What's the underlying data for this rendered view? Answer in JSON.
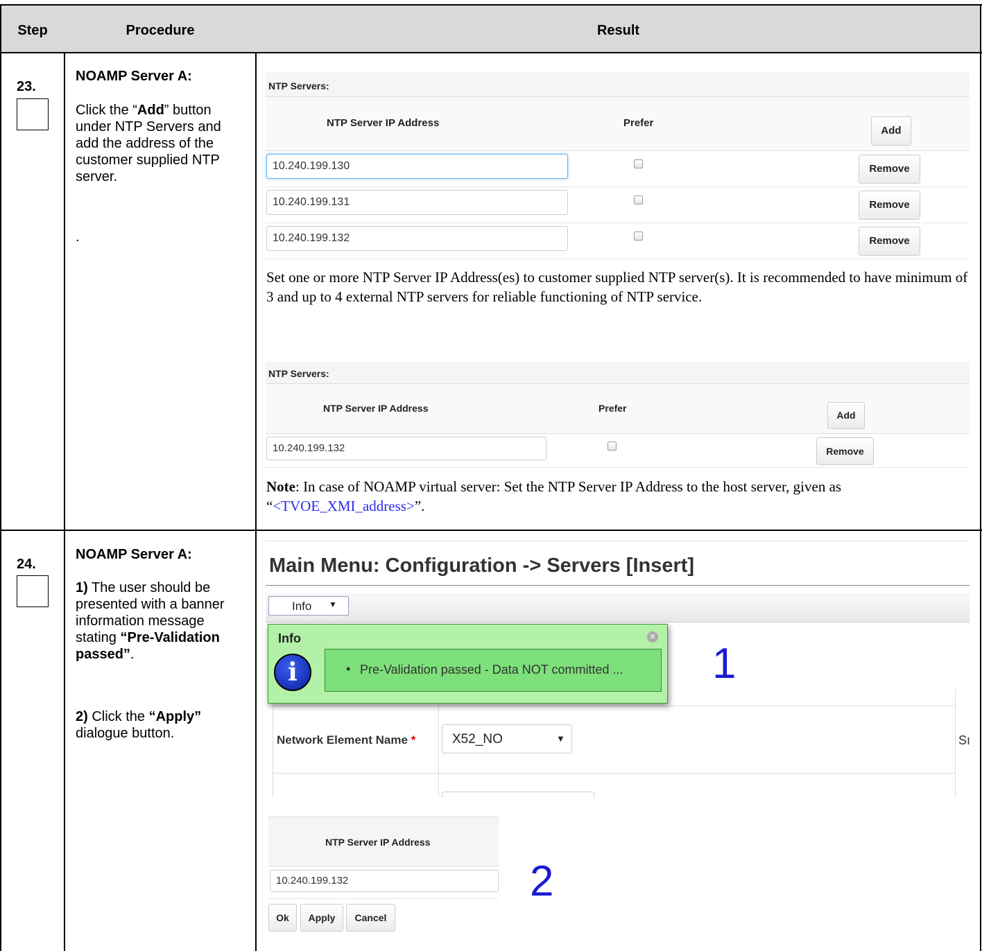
{
  "table": {
    "headers": {
      "step": "Step",
      "procedure": "Procedure",
      "result": "Result"
    }
  },
  "rows": [
    {
      "step": "23.",
      "procedure": {
        "title": "NOAMP Server A:",
        "p1_pre": "Click the “",
        "p1_bold": "Add",
        "p1_post": "” button under NTP Servers and add the address of the customer supplied NTP server.",
        "dot": "."
      },
      "result": {
        "panel1": {
          "section_title": "NTP Servers:",
          "col_ip": "NTP Server IP Address",
          "col_prefer": "Prefer",
          "add_button": "Add",
          "entries": [
            {
              "ip": "10.240.199.130",
              "remove": "Remove"
            },
            {
              "ip": "10.240.199.131",
              "remove": "Remove"
            },
            {
              "ip": "10.240.199.132",
              "remove": "Remove"
            }
          ]
        },
        "text1": "Set one or more NTP Server IP Address(es) to customer supplied NTP server(s).  It is recommended to have minimum of 3 and up to 4 external NTP servers for reliable functioning of NTP service.",
        "panel2": {
          "section_title": "NTP Servers:",
          "col_ip": "NTP Server IP Address",
          "col_prefer": "Prefer",
          "add_button": "Add",
          "entries": [
            {
              "ip": "10.240.199.132",
              "remove": "Remove"
            }
          ]
        },
        "note_label": "Note",
        "note_text": ": In case of NOAMP virtual server: Set the NTP Server IP Address to the host server, given as “",
        "note_link": "<TVOE_XMI_address>",
        "note_end": "”."
      }
    },
    {
      "step": "24.",
      "procedure": {
        "title": "NOAMP Server A:",
        "p1_num": "1)",
        "p1_text": " The user should be presented with a banner information message stating ",
        "p1_bold": "“Pre-Validation passed”",
        "p1_end": ".",
        "p2_num": "2)",
        "p2_text": " Click the ",
        "p2_bold": "“Apply”",
        "p2_end": " dialogue button."
      },
      "result": {
        "page_title": "Main Menu: Configuration -> Servers [Insert]",
        "info_dropdown": "Info",
        "banner_title": "Info",
        "banner_message": "Pre-Validation passed - Data NOT committed ...",
        "callout1": "1",
        "ne_label": "Network Element Name",
        "ne_required": "*",
        "ne_value": "X52_NO",
        "cutoff_text": "Sı",
        "ntp_col": "NTP Server IP Address",
        "ntp_value": "10.240.199.132",
        "callout2": "2",
        "buttons": {
          "ok": "Ok",
          "apply": "Apply",
          "cancel": "Cancel"
        }
      }
    }
  ],
  "colors": {
    "callout": "#1a1ad6",
    "link": "#2a2af0",
    "banner_bg": "#b3f0a8",
    "banner_msg_bg": "#7de07a"
  }
}
